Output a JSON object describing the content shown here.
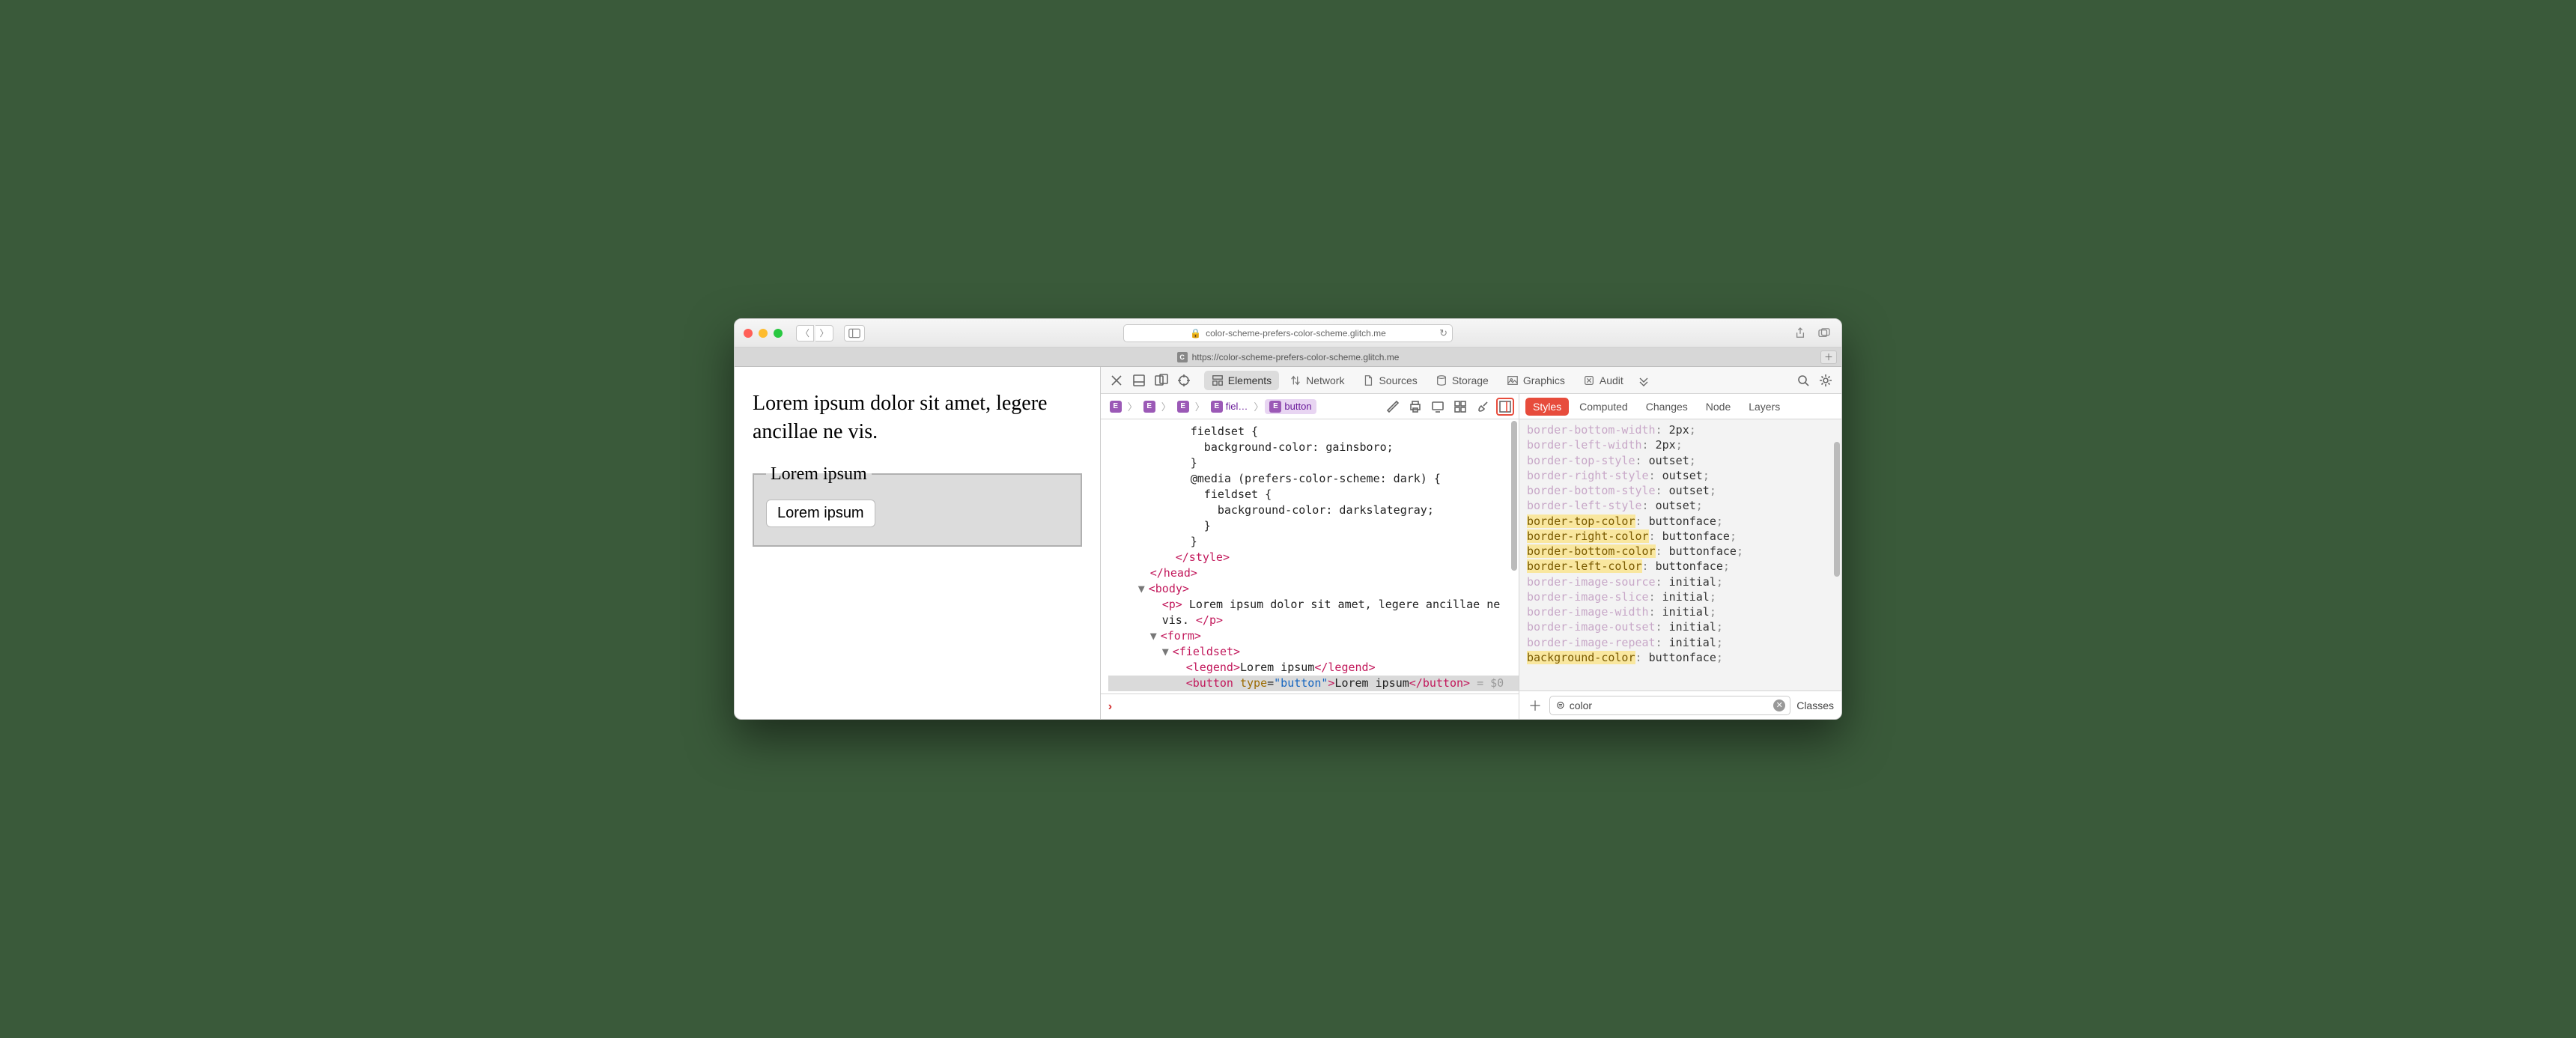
{
  "titlebar": {
    "url_display": "color-scheme-prefers-color-scheme.glitch.me",
    "lock_icon": "lock-icon"
  },
  "tabbar": {
    "favicon_letter": "C",
    "title": "https://color-scheme-prefers-color-scheme.glitch.me"
  },
  "page": {
    "paragraph": "Lorem ipsum dolor sit amet, legere ancillae ne vis.",
    "legend": "Lorem ipsum",
    "button": "Lorem ipsum"
  },
  "inspector_tabs": {
    "elements": "Elements",
    "network": "Network",
    "sources": "Sources",
    "storage": "Storage",
    "graphics": "Graphics",
    "audit": "Audit"
  },
  "breadcrumbs": [
    "",
    "",
    "",
    "fiel…",
    "button"
  ],
  "dom_source": {
    "l1": "fieldset {",
    "l2": "  background-color: gainsboro;",
    "l3": "}",
    "l4": "@media (prefers-color-scheme: dark) {",
    "l5": "  fieldset {",
    "l6": "    background-color: darkslategray;",
    "l7": "  }",
    "l8": "}",
    "close_style": "</style>",
    "close_head": "</head>",
    "body_open": "<body>",
    "p_open": "<p>",
    "p_text": " Lorem ipsum dolor sit amet, legere ancillae ne vis. ",
    "p_close": "</p>",
    "form_open": "<form>",
    "fieldset_open": "<fieldset>",
    "legend_open": "<legend>",
    "legend_text": "Lorem ipsum",
    "legend_close": "</legend>",
    "button_open": "<button",
    "button_attr": " type",
    "button_eq": "=",
    "button_val": "\"button\"",
    "button_gt": ">",
    "button_text": "Lorem ipsum",
    "button_close": "</button>",
    "dollar": " = $0"
  },
  "styles_tabs": {
    "styles": "Styles",
    "computed": "Computed",
    "changes": "Changes",
    "node": "Node",
    "layers": "Layers"
  },
  "rules": [
    {
      "prop": "border-bottom-width",
      "val": "2px",
      "hl": false,
      "dim": true,
      "trunc": true
    },
    {
      "prop": "border-left-width",
      "val": "2px",
      "hl": false,
      "dim": true
    },
    {
      "prop": "border-top-style",
      "val": "outset",
      "hl": false,
      "dim": true
    },
    {
      "prop": "border-right-style",
      "val": "outset",
      "hl": false,
      "dim": true
    },
    {
      "prop": "border-bottom-style",
      "val": "outset",
      "hl": false,
      "dim": true
    },
    {
      "prop": "border-left-style",
      "val": "outset",
      "hl": false,
      "dim": true
    },
    {
      "prop": "border-top-color",
      "val": "buttonface",
      "hl": true
    },
    {
      "prop": "border-right-color",
      "val": "buttonface",
      "hl": true
    },
    {
      "prop": "border-bottom-color",
      "val": "buttonface",
      "hl": true
    },
    {
      "prop": "border-left-color",
      "val": "buttonface",
      "hl": true
    },
    {
      "prop": "border-image-source",
      "val": "initial",
      "hl": false,
      "dim": true
    },
    {
      "prop": "border-image-slice",
      "val": "initial",
      "hl": false,
      "dim": true
    },
    {
      "prop": "border-image-width",
      "val": "initial",
      "hl": false,
      "dim": true
    },
    {
      "prop": "border-image-outset",
      "val": "initial",
      "hl": false,
      "dim": true
    },
    {
      "prop": "border-image-repeat",
      "val": "initial",
      "hl": false,
      "dim": true
    },
    {
      "prop": "background-color",
      "val": "buttonface",
      "hl": true
    }
  ],
  "filter": {
    "value": "color",
    "classes_label": "Classes"
  }
}
